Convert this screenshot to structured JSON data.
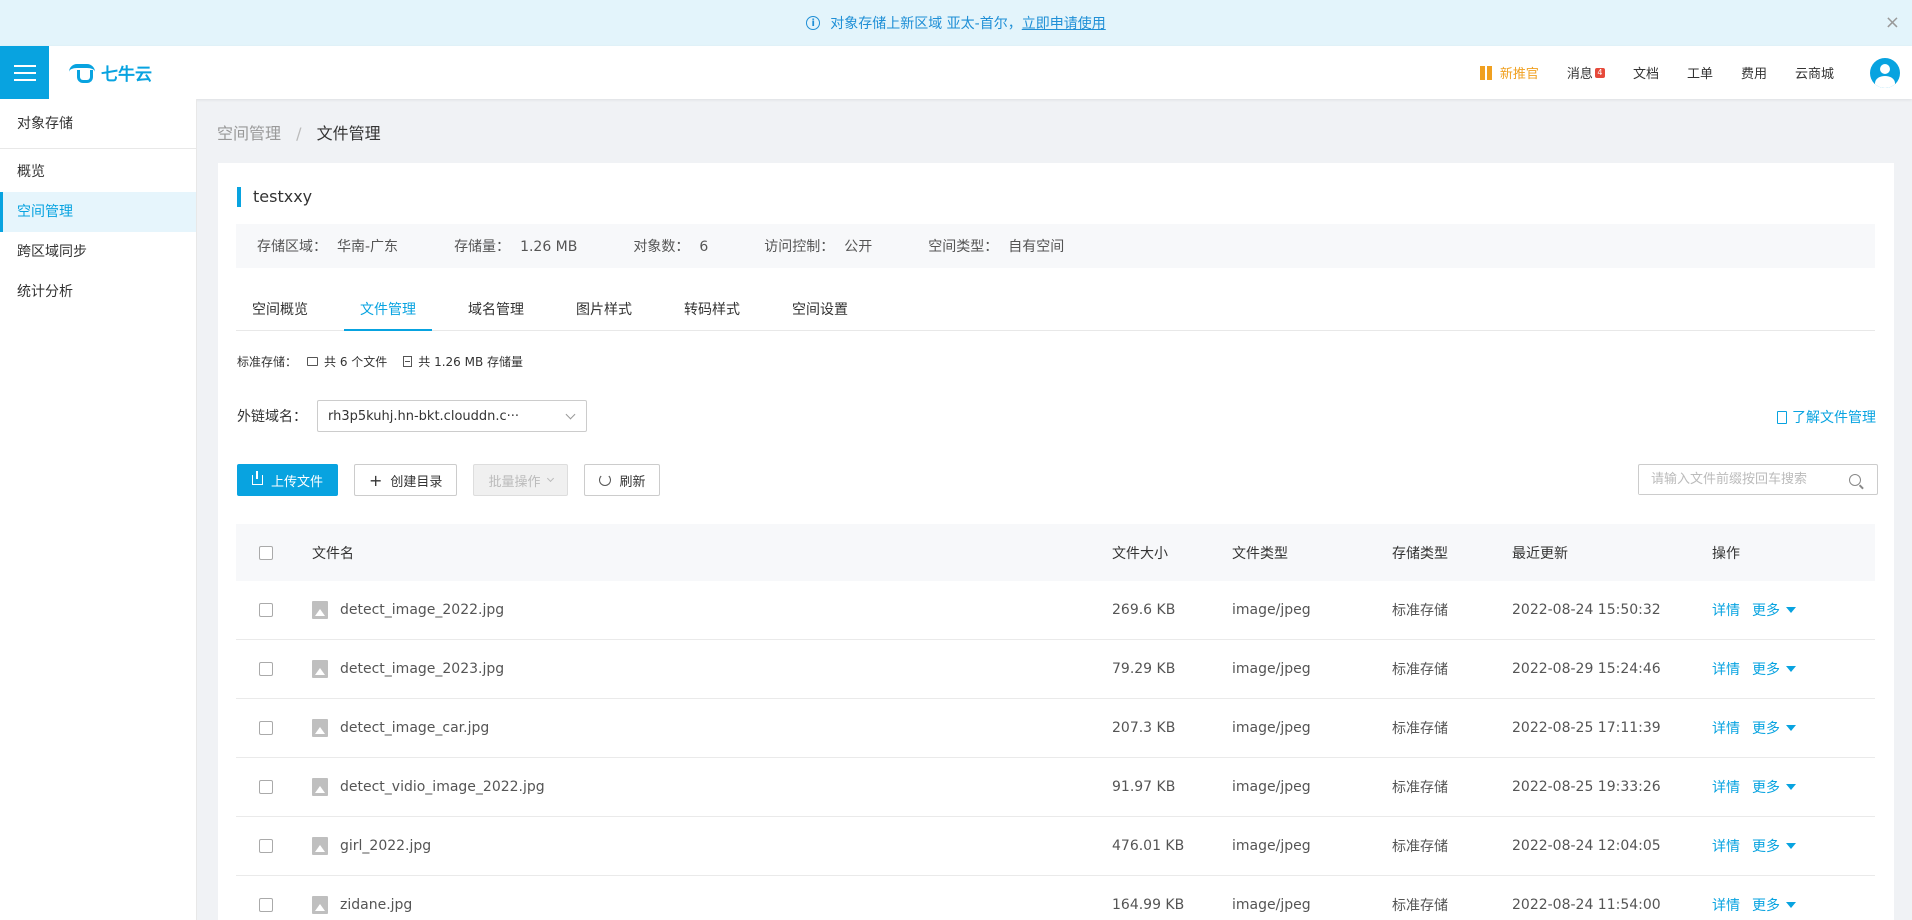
{
  "notice": {
    "text": "对象存储上新区域 亚太-首尔，",
    "link": "立即申请使用",
    "close": "×",
    "info_glyph": "i"
  },
  "header": {
    "logo_text": "七牛云",
    "nav": {
      "promo": "新推官",
      "messages": "消息",
      "message_badge": "4",
      "docs": "文档",
      "tickets": "工单",
      "billing": "费用",
      "marketplace": "云商城"
    },
    "accent_color": "#08a3e0"
  },
  "sidebar": {
    "group_title": "对象存储",
    "items": [
      {
        "label": "概览"
      },
      {
        "label": "空间管理"
      },
      {
        "label": "跨区域同步"
      },
      {
        "label": "统计分析"
      }
    ]
  },
  "breadcrumb": {
    "parent": "空间管理",
    "separator": "/",
    "current": "文件管理"
  },
  "bucket": {
    "name": "testxxy",
    "info": [
      {
        "label": "存储区域：",
        "value": "华南-广东"
      },
      {
        "label": "存储量：",
        "value": "1.26 MB"
      },
      {
        "label": "对象数：",
        "value": "6"
      },
      {
        "label": "访问控制：",
        "value": "公开"
      },
      {
        "label": "空间类型：",
        "value": "自有空间"
      }
    ]
  },
  "tabs": [
    {
      "label": "空间概览"
    },
    {
      "label": "文件管理"
    },
    {
      "label": "域名管理"
    },
    {
      "label": "图片样式"
    },
    {
      "label": "转码样式"
    },
    {
      "label": "空间设置"
    }
  ],
  "summary": {
    "label": "标准存储：",
    "files": "共 6 个文件",
    "storage": "共 1.26 MB 存储量"
  },
  "domain": {
    "label": "外链域名：",
    "value": "rh3p5kuhj.hn-bkt.clouddn.c···"
  },
  "learn_link": "了解文件管理",
  "toolbar": {
    "upload": "上传文件",
    "create_dir": "创建目录",
    "batch": "批量操作",
    "refresh": "刷新",
    "search_placeholder": "请输入文件前缀按回车搜索"
  },
  "table": {
    "headers": {
      "name": "文件名",
      "size": "文件大小",
      "type": "文件类型",
      "storage": "存储类型",
      "updated": "最近更新",
      "ops": "操作"
    },
    "rows": [
      {
        "name": "detect_image_2022.jpg",
        "size": "269.6 KB",
        "type": "image/jpeg",
        "storage": "标准存储",
        "updated": "2022-08-24 15:50:32"
      },
      {
        "name": "detect_image_2023.jpg",
        "size": "79.29 KB",
        "type": "image/jpeg",
        "storage": "标准存储",
        "updated": "2022-08-29 15:24:46"
      },
      {
        "name": "detect_image_car.jpg",
        "size": "207.3 KB",
        "type": "image/jpeg",
        "storage": "标准存储",
        "updated": "2022-08-25 17:11:39"
      },
      {
        "name": "detect_vidio_image_2022.jpg",
        "size": "91.97 KB",
        "type": "image/jpeg",
        "storage": "标准存储",
        "updated": "2022-08-25 19:33:26"
      },
      {
        "name": "girl_2022.jpg",
        "size": "476.01 KB",
        "type": "image/jpeg",
        "storage": "标准存储",
        "updated": "2022-08-24 12:04:05"
      },
      {
        "name": "zidane.jpg",
        "size": "164.99 KB",
        "type": "image/jpeg",
        "storage": "标准存储",
        "updated": "2022-08-24 11:54:00"
      }
    ],
    "op_detail": "详情",
    "op_more": "更多"
  }
}
